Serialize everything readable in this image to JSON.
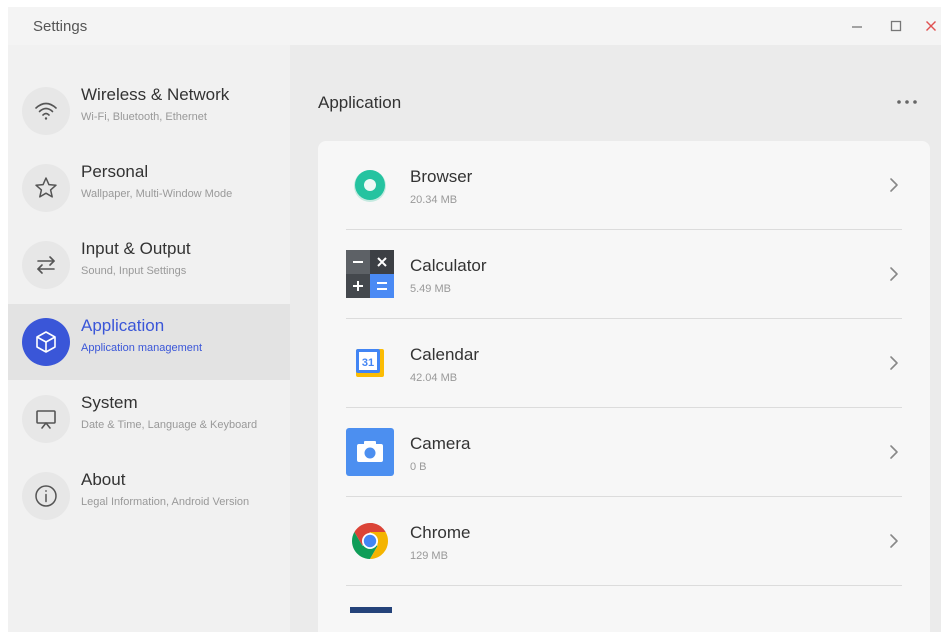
{
  "window": {
    "title": "Settings"
  },
  "sidebar": {
    "items": [
      {
        "title": "Wireless & Network",
        "subtitle": "Wi-Fi, Bluetooth, Ethernet",
        "icon": "wifi-icon"
      },
      {
        "title": "Personal",
        "subtitle": "Wallpaper, Multi-Window Mode",
        "icon": "star-icon"
      },
      {
        "title": "Input & Output",
        "subtitle": "Sound, Input Settings",
        "icon": "swap-arrows-icon"
      },
      {
        "title": "Application",
        "subtitle": "Application management",
        "icon": "cube-icon",
        "active": true
      },
      {
        "title": "System",
        "subtitle": "Date & Time, Language & Keyboard",
        "icon": "monitor-icon"
      },
      {
        "title": "About",
        "subtitle": "Legal Information, Android Version",
        "icon": "info-icon"
      }
    ]
  },
  "main": {
    "title": "Application",
    "apps": [
      {
        "name": "Browser",
        "size": "20.34 MB",
        "icon": "browser-icon"
      },
      {
        "name": "Calculator",
        "size": "5.49 MB",
        "icon": "calculator-icon"
      },
      {
        "name": "Calendar",
        "size": "42.04 MB",
        "icon": "calendar-icon",
        "icon_text": "31"
      },
      {
        "name": "Camera",
        "size": "0 B",
        "icon": "camera-icon"
      },
      {
        "name": "Chrome",
        "size": "129 MB",
        "icon": "chrome-icon"
      }
    ]
  },
  "colors": {
    "accent": "#3a56d8",
    "close": "#e05050"
  }
}
